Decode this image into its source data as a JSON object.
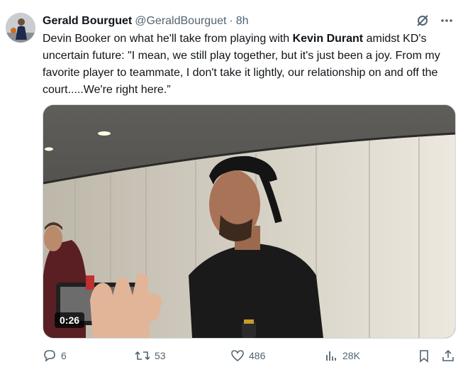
{
  "tweet": {
    "author_name": "Gerald Bourguet",
    "handle": "@GeraldBourguet",
    "separator": "·",
    "time": "8h",
    "text_part1": "Devin Booker on what he'll take from playing with ",
    "text_bold": "Kevin Durant",
    "text_part2": " amidst KD's uncertain future: \"I mean, we still play together, but it's just been a joy. From my favorite player to teammate, I don't take it lightly, our relationship on and off the court.....We're right here.”",
    "video_duration": "0:26"
  },
  "actions": {
    "replies": "6",
    "retweets": "53",
    "likes": "486",
    "views": "28K"
  },
  "icons": {
    "grok": "grok-icon",
    "more": "more-icon",
    "reply": "reply-icon",
    "retweet": "retweet-icon",
    "like": "like-icon",
    "views": "views-icon",
    "bookmark": "bookmark-icon",
    "share": "share-icon"
  },
  "colors": {
    "text": "#0f1419",
    "muted": "#536471",
    "border": "#cfd9de"
  }
}
